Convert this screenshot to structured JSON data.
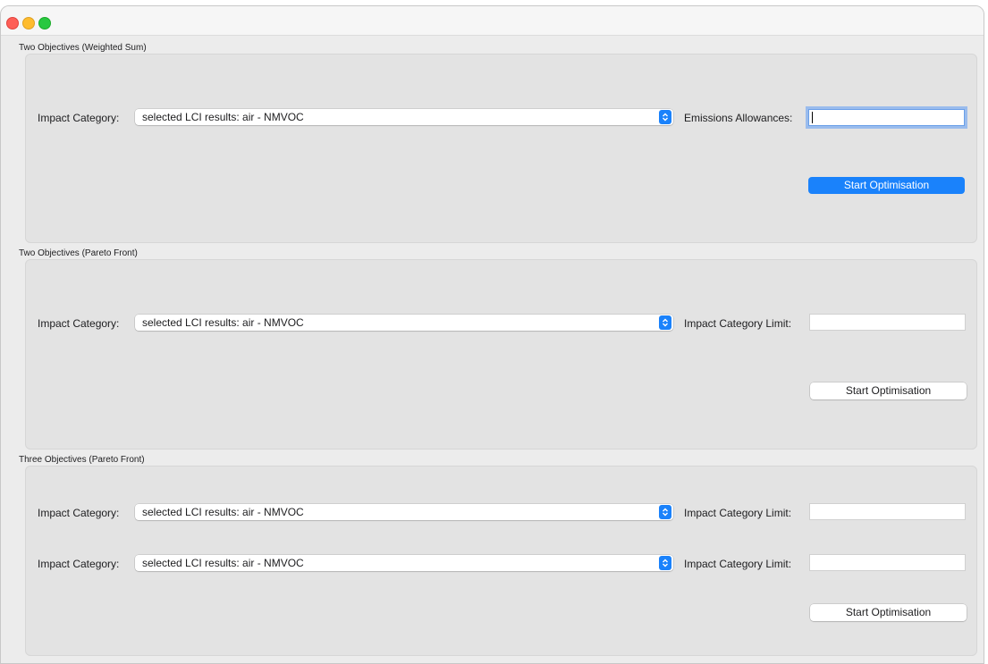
{
  "groups": [
    {
      "title": "Two Objectives (Weighted Sum)",
      "rows": [
        {
          "label": "Impact Category:",
          "selected": "selected LCI results: air - NMVOC",
          "field_label": "Emissions Allowances:",
          "field_value": ""
        }
      ],
      "button": "Start Optimisation"
    },
    {
      "title": "Two Objectives (Pareto Front)",
      "rows": [
        {
          "label": "Impact Category:",
          "selected": "selected LCI results: air - NMVOC",
          "field_label": "Impact Category Limit:",
          "field_value": ""
        }
      ],
      "button": "Start Optimisation"
    },
    {
      "title": "Three Objectives (Pareto Front)",
      "rows": [
        {
          "label": "Impact Category:",
          "selected": "selected LCI results: air - NMVOC",
          "field_label": "Impact Category Limit:",
          "field_value": ""
        },
        {
          "label": "Impact Category:",
          "selected": "selected LCI results: air - NMVOC",
          "field_label": "Impact Category Limit:",
          "field_value": ""
        }
      ],
      "button": "Start Optimisation"
    }
  ],
  "colors": {
    "accent": "#1a82fb",
    "panel": "#e3e3e3",
    "window": "#ececec"
  }
}
